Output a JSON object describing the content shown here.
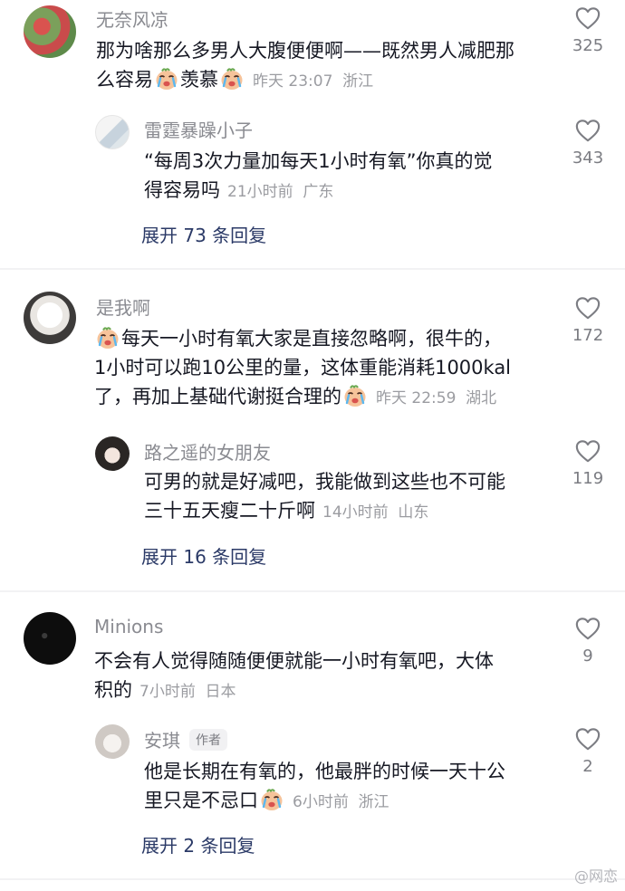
{
  "comments": [
    {
      "user": "无奈风凉",
      "text_parts": [
        "那为啥那么多男人大腹便便啊——既然男人减肥那",
        "么容易",
        "羡慕"
      ],
      "time": "昨天 23:07",
      "location": "浙江",
      "likes": "325",
      "reply": {
        "user": "雷霆暴躁小子",
        "text_parts": [
          "“每周3次力量加每天1小时有氧”你真的觉",
          "得容易吗"
        ],
        "time": "21小时前",
        "location": "广东",
        "likes": "343"
      },
      "expand": "展开 73 条回复"
    },
    {
      "user": "是我啊",
      "text_parts": [
        "每天一小时有氧大家是直接忽略啊，很牛的，",
        "1小时可以跑10公里的量，这体重能消耗1000kal",
        "了，再加上基础代谢挺合理的"
      ],
      "time": "昨天 22:59",
      "location": "湖北",
      "likes": "172",
      "reply": {
        "user": "路之遥的女朋友",
        "text_parts": [
          "可男的就是好减吧，我能做到这些也不可能",
          "三十五天瘦二十斤啊"
        ],
        "time": "14小时前",
        "location": "山东",
        "likes": "119"
      },
      "expand": "展开 16 条回复"
    },
    {
      "user": "Minions",
      "text_parts": [
        "不会有人觉得随随便便就能一小时有氧吧，大体",
        "积的"
      ],
      "time": "7小时前",
      "location": "日本",
      "likes": "9",
      "reply": {
        "user": "安琪",
        "badge": "作者",
        "text_parts": [
          "他是长期在有氧的，他最胖的时候一天十公",
          "里只是不忌口"
        ],
        "time": "6小时前",
        "location": "浙江",
        "likes": "2"
      },
      "expand": "展开 2 条回复"
    }
  ],
  "watermark": "@网恋",
  "colors": {
    "text": "#161823",
    "username": "#8a8b91",
    "meta": "#9b9ca1",
    "expand": "#2b3a67",
    "separator": "#f2f2f4"
  },
  "icons": {
    "like": "heart-outline-icon",
    "emoji": "crying-face-emoji-icon"
  }
}
